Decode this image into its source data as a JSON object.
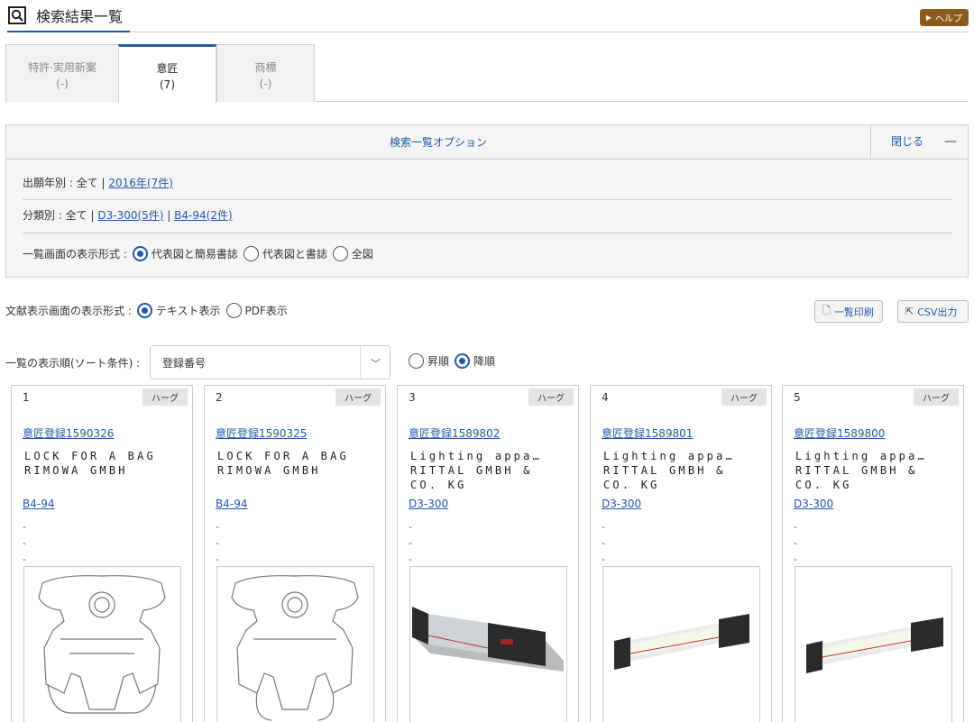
{
  "header": {
    "title": "検索結果一覧",
    "help": "ヘルプ"
  },
  "tabs": [
    {
      "label": "特許·実用新案",
      "count": "(-)"
    },
    {
      "label": "意匠",
      "count": "(7)"
    },
    {
      "label": "商標",
      "count": "(-)"
    }
  ],
  "options": {
    "title": "検索一覧オプション",
    "close": "閉じる",
    "year_label": "出願年別 : 全て |",
    "year_link": "2016年(7件)",
    "class_label": "分類別 : 全て |",
    "class_link1": "D3-300(5件)",
    "class_sep": "|",
    "class_link2": "B4-94(2件)",
    "view_label": "一覧画面の表示形式 :",
    "view_opt1": "代表図と簡易書誌",
    "view_opt2": "代表図と書誌",
    "view_opt3": "全図"
  },
  "doc_format": {
    "label": "文献表示画面の表示形式 :",
    "opt1": "テキスト表示",
    "opt2": "PDF表示"
  },
  "buttons": {
    "print": "一覧印刷",
    "csv": "CSV出力"
  },
  "sort": {
    "label": "一覧の表示順(ソート条件) :",
    "value": "登録番号",
    "asc": "昇順",
    "desc": "降順"
  },
  "cards": [
    {
      "num": "1",
      "office": "ハーグ",
      "reg": "意匠登録1590326",
      "name1": "LOCK FOR A BAG",
      "name2": "RIMOWA GMBH",
      "name3": "",
      "cls": "B4-94",
      "d1": "-",
      "d2": "-",
      "d3": "-"
    },
    {
      "num": "2",
      "office": "ハーグ",
      "reg": "意匠登録1590325",
      "name1": "LOCK FOR A BAG",
      "name2": "RIMOWA GMBH",
      "name3": "",
      "cls": "B4-94",
      "d1": "-",
      "d2": "-",
      "d3": "-"
    },
    {
      "num": "3",
      "office": "ハーグ",
      "reg": "意匠登録1589802",
      "name1": "Lighting appa…",
      "name2": "RITTAL GMBH &",
      "name3": "CO. KG",
      "cls": "D3-300",
      "d1": "-",
      "d2": "-",
      "d3": "-"
    },
    {
      "num": "4",
      "office": "ハーグ",
      "reg": "意匠登録1589801",
      "name1": "Lighting appa…",
      "name2": "RITTAL GMBH &",
      "name3": "CO. KG",
      "cls": "D3-300",
      "d1": "-",
      "d2": "-",
      "d3": "-"
    },
    {
      "num": "5",
      "office": "ハーグ",
      "reg": "意匠登録1589800",
      "name1": "Lighting appa…",
      "name2": "RITTAL GMBH &",
      "name3": "CO. KG",
      "cls": "D3-300",
      "d1": "-",
      "d2": "-",
      "d3": "-"
    }
  ]
}
